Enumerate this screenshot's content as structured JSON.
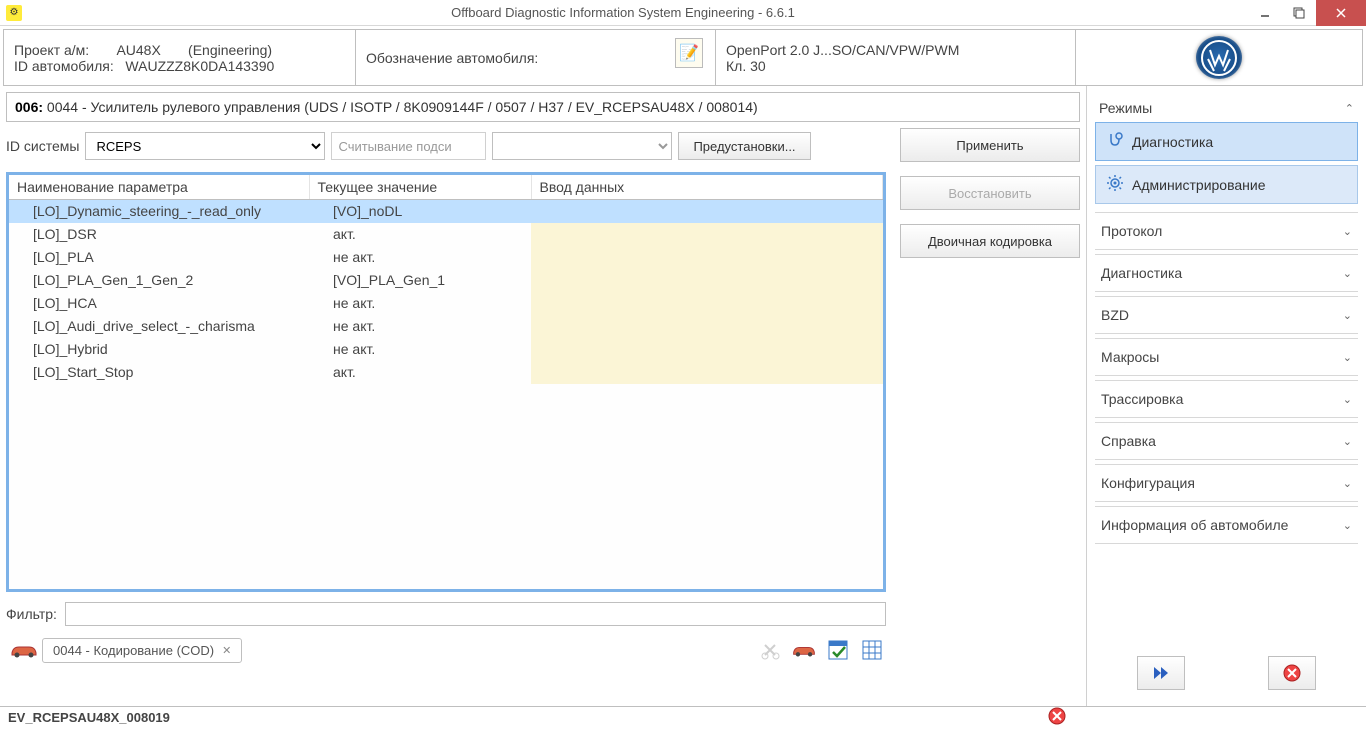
{
  "window": {
    "title": "Offboard Diagnostic Information System Engineering - 6.6.1"
  },
  "header": {
    "project_label": "Проект а/м:",
    "project_value": "AU48X",
    "project_mode": "(Engineering)",
    "vehicle_id_label": "ID автомобиля:",
    "vehicle_id_value": "WAUZZZ8K0DA143390",
    "vehicle_desig_label": "Обозначение автомобиля:",
    "connection": "OpenPort 2.0 J...SO/CAN/VPW/PWM",
    "kl": "Кл. 30"
  },
  "descriptor": {
    "bold": "006:",
    "rest": "0044 - Усилитель рулевого управления  (UDS / ISOTP / 8K0909144F  / 0507 / H37 / EV_RCEPSAU48X / 008014)"
  },
  "controls": {
    "system_id_label": "ID системы",
    "system_id_value": "RCEPS",
    "readsub_placeholder": "Считывание подси",
    "presets_label": "Предустановки...",
    "apply_label": "Применить",
    "restore_label": "Восстановить",
    "binary_label": "Двоичная кодировка"
  },
  "table": {
    "col_name": "Наименование параметра",
    "col_value": "Текущее значение",
    "col_input": "Ввод данных",
    "rows": [
      {
        "name": "[LO]_Dynamic_steering_-_read_only",
        "value": "[VO]_noDL",
        "selected": true
      },
      {
        "name": "[LO]_DSR",
        "value": "акт."
      },
      {
        "name": "[LO]_PLA",
        "value": "не акт."
      },
      {
        "name": "[LO]_PLA_Gen_1_Gen_2",
        "value": "[VO]_PLA_Gen_1"
      },
      {
        "name": "[LO]_HCA",
        "value": "не акт."
      },
      {
        "name": "[LO]_Audi_drive_select_-_charisma",
        "value": "не акт."
      },
      {
        "name": "[LO]_Hybrid",
        "value": "не акт."
      },
      {
        "name": "[LO]_Start_Stop",
        "value": "акт."
      }
    ]
  },
  "filter": {
    "label": "Фильтр:"
  },
  "tab": {
    "label": "0044 - Кодирование (COD)"
  },
  "sidebar": {
    "modes_title": "Режимы",
    "diag_btn": "Диагностика",
    "admin_btn": "Администрирование",
    "sections": [
      "Протокол",
      "Диагностика",
      "BZD",
      "Макросы",
      "Трассировка",
      "Справка",
      "Конфигурация",
      "Информация об автомобиле"
    ]
  },
  "status": {
    "text": "EV_RCEPSAU48X_008019"
  }
}
